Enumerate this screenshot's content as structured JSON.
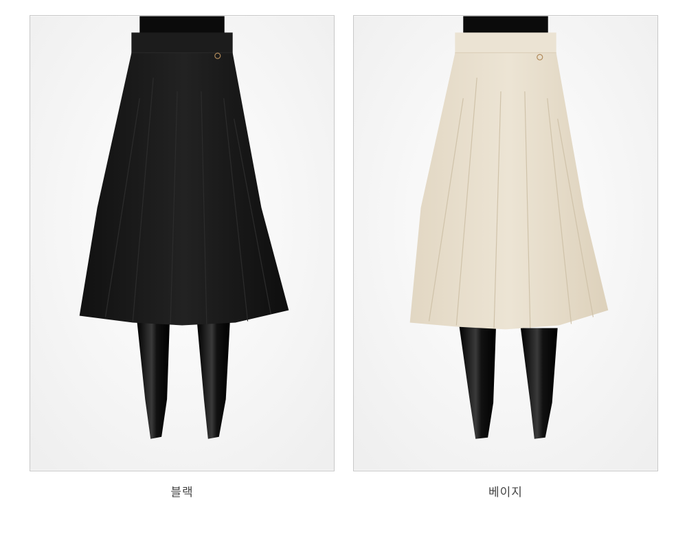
{
  "products": [
    {
      "color_name": "블랙",
      "swatch": "#1a1a1a",
      "swatch_shade": "#0c0c0c",
      "pleat_line": "#2c2c2c",
      "waist_line": "#2a2a2a"
    },
    {
      "color_name": "베이지",
      "swatch": "#e8dfcd",
      "swatch_shade": "#d6cab3",
      "pleat_line": "#cfc2a9",
      "waist_line": "#d9cdb6"
    }
  ],
  "mannequin_color": "#0b0b0b",
  "background": "#f7f7f7"
}
